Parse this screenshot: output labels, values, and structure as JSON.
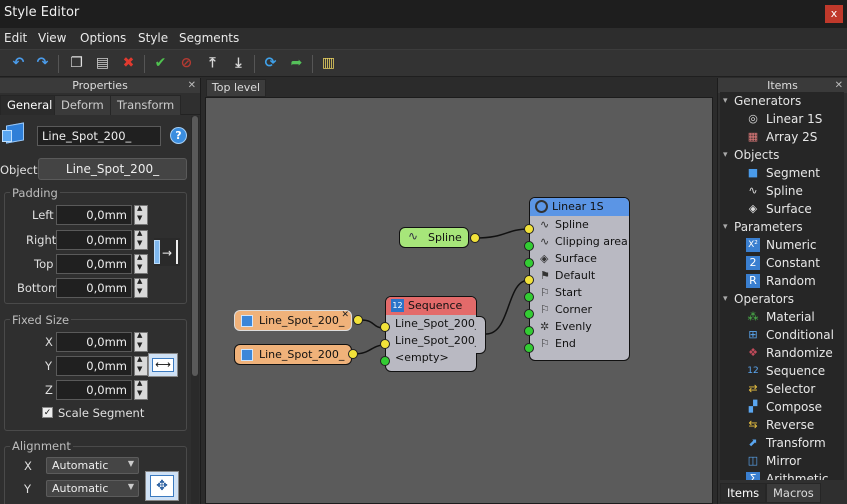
{
  "window": {
    "title": "Style Editor",
    "close_glyph": "x"
  },
  "menu": [
    "Edit",
    "View",
    "Options",
    "Style",
    "Segments"
  ],
  "toolbar": {
    "icons": [
      "undo-icon",
      "redo-icon",
      "copy-icon",
      "paste-icon",
      "delete-icon",
      "apply-check-icon",
      "cancel-icon",
      "move-top-icon",
      "move-bottom-icon",
      "refresh-icon",
      "export-icon",
      "notes-icon"
    ]
  },
  "properties": {
    "title": "Properties",
    "tabs": [
      "General",
      "Deform",
      "Transform"
    ],
    "name_value": "Line_Spot_200_",
    "help_glyph": "?",
    "object_label": "Object",
    "object_value": "Line_Spot_200_",
    "padding": {
      "title": "Padding",
      "left_label": "Left",
      "left_value": "0,0mm",
      "right_label": "Right",
      "right_value": "0,0mm",
      "top_label": "Top",
      "top_value": "0,0mm",
      "bottom_label": "Bottom",
      "bottom_value": "0,0mm"
    },
    "fixed_size": {
      "title": "Fixed Size",
      "x_label": "X",
      "x_value": "0,0mm",
      "y_label": "Y",
      "y_value": "0,0mm",
      "z_label": "Z",
      "z_value": "0,0mm",
      "scale_segment_label": "Scale Segment",
      "scale_segment_checked": true
    },
    "alignment": {
      "title": "Alignment",
      "x_label": "X",
      "x_value": "Automatic",
      "y_label": "Y",
      "y_value": "Automatic"
    }
  },
  "canvas": {
    "tab": "Top level",
    "nodes": {
      "spline": {
        "label": "Spline"
      },
      "source1": {
        "label": "Line_Spot_200_"
      },
      "source2": {
        "label": "Line_Spot_200_"
      },
      "sequence": {
        "title": "Sequence",
        "inputs": [
          "Line_Spot_200_",
          "Line_Spot_200_",
          "<empty>"
        ]
      },
      "linear": {
        "title": "Linear 1S",
        "inputs": [
          "Spline",
          "Clipping area",
          "Surface",
          "Default",
          "Start",
          "Corner",
          "Evenly",
          "End"
        ]
      }
    }
  },
  "items": {
    "title": "Items",
    "categories": [
      {
        "name": "Generators",
        "items": [
          {
            "label": "Linear 1S",
            "icon": "linear-icon"
          },
          {
            "label": "Array 2S",
            "icon": "array-icon"
          }
        ]
      },
      {
        "name": "Objects",
        "items": [
          {
            "label": "Segment",
            "icon": "segment-icon"
          },
          {
            "label": "Spline",
            "icon": "spline-icon"
          },
          {
            "label": "Surface",
            "icon": "surface-icon"
          }
        ]
      },
      {
        "name": "Parameters",
        "items": [
          {
            "label": "Numeric",
            "icon": "numeric-icon"
          },
          {
            "label": "Constant",
            "icon": "constant-icon"
          },
          {
            "label": "Random",
            "icon": "random-icon"
          }
        ]
      },
      {
        "name": "Operators",
        "items": [
          {
            "label": "Material",
            "icon": "material-icon"
          },
          {
            "label": "Conditional",
            "icon": "conditional-icon"
          },
          {
            "label": "Randomize",
            "icon": "randomize-icon"
          },
          {
            "label": "Sequence",
            "icon": "sequence-icon"
          },
          {
            "label": "Selector",
            "icon": "selector-icon"
          },
          {
            "label": "Compose",
            "icon": "compose-icon"
          },
          {
            "label": "Reverse",
            "icon": "reverse-icon"
          },
          {
            "label": "Transform",
            "icon": "transform-icon"
          },
          {
            "label": "Mirror",
            "icon": "mirror-icon"
          },
          {
            "label": "Arithmetic",
            "icon": "arithmetic-icon"
          }
        ]
      }
    ],
    "tabs": [
      "Items",
      "Macros"
    ]
  }
}
